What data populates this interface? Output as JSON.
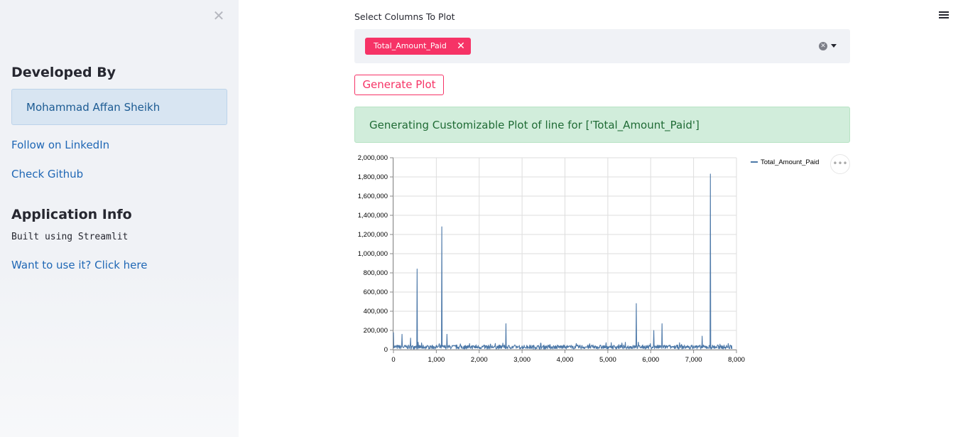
{
  "sidebar": {
    "close_glyph": "✕",
    "developed_heading": "Developed By",
    "developer_name": "Mohammad Affan Sheikh",
    "linkedin_link": "Follow on LinkedIn",
    "github_link": "Check Github",
    "app_info_heading": "Application Info",
    "built_using": "Built using Streamlit",
    "use_it_link": "Want to use it? Click here"
  },
  "main": {
    "select_label": "Select Columns To Plot",
    "selected_chips": [
      "Total_Amount_Paid"
    ],
    "chip_remove_glyph": "✕",
    "clear_glyph": "✕",
    "generate_button": "Generate Plot",
    "success_message": "Generating Customizable Plot of line for ['Total_Amount_Paid']",
    "more_glyph": "•••"
  },
  "colors": {
    "accent": "#f63366",
    "line": "#4c78a8",
    "sidebar_bg": "#f0f2f6",
    "success_bg": "#d1eddb",
    "link": "#1f67b5"
  },
  "chart_data": {
    "type": "line",
    "series": [
      {
        "name": "Total_Amount_Paid"
      }
    ],
    "xlim": [
      0,
      8000
    ],
    "ylim": [
      0,
      2000000
    ],
    "x_ticks": [
      0,
      1000,
      2000,
      3000,
      4000,
      5000,
      6000,
      7000,
      8000
    ],
    "y_ticks": [
      0,
      200000,
      400000,
      600000,
      800000,
      1000000,
      1200000,
      1400000,
      1600000,
      1800000,
      2000000
    ],
    "x_tick_labels": [
      "0",
      "1,000",
      "2,000",
      "3,000",
      "4,000",
      "5,000",
      "6,000",
      "7,000",
      "8,000"
    ],
    "y_tick_labels": [
      "0",
      "200,000",
      "400,000",
      "600,000",
      "800,000",
      "1,000,000",
      "1,200,000",
      "1,400,000",
      "1,600,000",
      "1,800,000",
      "2,000,000"
    ],
    "grid": true,
    "legend_position": "top-right",
    "x_max_data": 7900,
    "spikes": [
      {
        "x": 0,
        "y": 180000
      },
      {
        "x": 200,
        "y": 160000
      },
      {
        "x": 400,
        "y": 120000
      },
      {
        "x": 550,
        "y": 840000
      },
      {
        "x": 1130,
        "y": 1280000
      },
      {
        "x": 1250,
        "y": 160000
      },
      {
        "x": 2620,
        "y": 270000
      },
      {
        "x": 5660,
        "y": 480000
      },
      {
        "x": 6070,
        "y": 200000
      },
      {
        "x": 6260,
        "y": 270000
      },
      {
        "x": 7200,
        "y": 140000
      },
      {
        "x": 7390,
        "y": 1830000
      }
    ],
    "baseline_level": 30000
  }
}
